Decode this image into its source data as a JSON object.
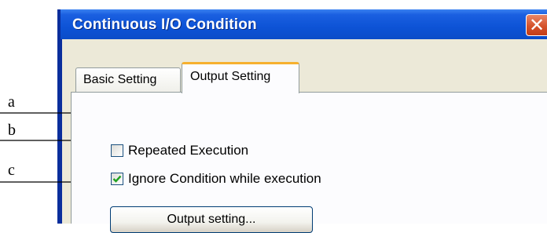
{
  "window": {
    "title": "Continuous I/O Condition",
    "close_glyph": "✕"
  },
  "tabs": [
    {
      "label": "Basic Setting",
      "active": false
    },
    {
      "label": "Output Setting",
      "active": true
    }
  ],
  "options": {
    "repeated_execution": {
      "label": "Repeated Execution",
      "checked": false
    },
    "ignore_condition": {
      "label": "Ignore Condition while execution",
      "checked": true
    }
  },
  "buttons": {
    "output_setting": "Output setting..."
  },
  "annotations": [
    "a",
    "b",
    "c"
  ],
  "colors": {
    "titlebar": "#0b4cc8",
    "dialog_face": "#ece9d8",
    "tab_accent": "#f6b02e",
    "check_mark": "#21a121"
  }
}
